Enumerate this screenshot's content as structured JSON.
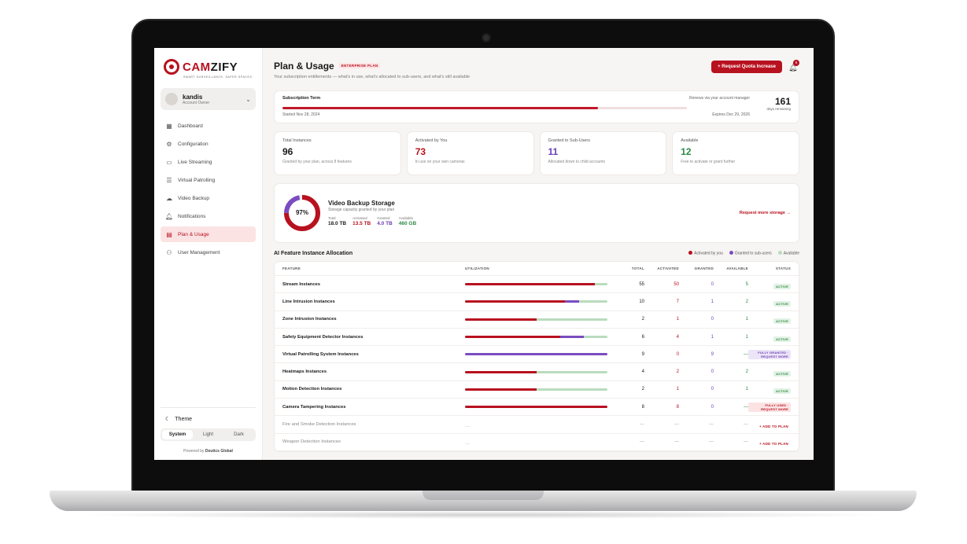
{
  "brand": {
    "name_a": "CAM",
    "name_b": "ZIFY",
    "tagline": "Smart Surveillance, Safer Spaces"
  },
  "user": {
    "name": "kandis",
    "role": "Account Owner"
  },
  "nav": [
    {
      "label": "Dashboard",
      "icon": "grid-icon"
    },
    {
      "label": "Configuration",
      "icon": "gear-icon"
    },
    {
      "label": "Live Streaming",
      "icon": "video-icon"
    },
    {
      "label": "Virtual Patrolling",
      "icon": "server-icon"
    },
    {
      "label": "Video Backup",
      "icon": "cloud-icon"
    },
    {
      "label": "Notifications",
      "icon": "bell-icon"
    },
    {
      "label": "Plan & Usage",
      "icon": "document-icon"
    },
    {
      "label": "User Management",
      "icon": "users-icon"
    }
  ],
  "theme": {
    "title": "Theme",
    "options": [
      "System",
      "Light",
      "Dark"
    ],
    "selected": "System"
  },
  "powered_by": {
    "prefix": "Powered by",
    "name": "Deutics Global"
  },
  "header": {
    "title": "Plan & Usage",
    "badge": "ENTERPRISE PLAN",
    "subtitle": "Your subscription entitlements — what's in use, what's allocated to sub-users, and what's still available",
    "quota_button": "+ Request Quota Increase",
    "notification_count": "6"
  },
  "term": {
    "label": "Subscription Term",
    "started": "Started Nov 28, 2024",
    "renews": "Renews via your account manager",
    "expires": "Expires Dec 29, 2026",
    "days": "161",
    "days_label": "days remaining",
    "progress": 0.78
  },
  "stats": [
    {
      "label": "Total Instances",
      "value": "96",
      "sub": "Granted by your plan, across 8 features",
      "color": "#1a1a1a"
    },
    {
      "label": "Activated by You",
      "value": "73",
      "sub": "In use on your own cameras",
      "color": "#b8111f"
    },
    {
      "label": "Granted to Sub-Users",
      "value": "11",
      "sub": "Allocated down to child accounts",
      "color": "#6b3fb5"
    },
    {
      "label": "Available",
      "value": "12",
      "sub": "Free to activate or grant further",
      "color": "#2f8a46"
    }
  ],
  "storage": {
    "percent_label": "97%",
    "title": "Video Backup Storage",
    "subtitle": "Storage capacity granted by your plan",
    "total_label": "Total",
    "total": "18.0 TB",
    "activated_label": "Activated",
    "activated": "13.5 TB",
    "granted_label": "Granted",
    "granted": "4.0 TB",
    "available_label": "Available",
    "available": "460 GB",
    "link": "Request more storage →"
  },
  "allocation": {
    "title": "AI Feature Instance Allocation",
    "legend": [
      "Activated by you",
      "Granted to sub-users",
      "Available"
    ],
    "columns": [
      "FEATURE",
      "UTILIZATION",
      "TOTAL",
      "ACTIVATED",
      "GRANTED",
      "AVAILABLE",
      "STATUS"
    ],
    "rows": [
      {
        "feature": "Stream Instances",
        "total": "55",
        "activated": "50",
        "granted": "0",
        "available": "5",
        "status": "ACTIVE",
        "kind": "green"
      },
      {
        "feature": "Line Intrusion Instances",
        "total": "10",
        "activated": "7",
        "granted": "1",
        "available": "2",
        "status": "ACTIVE",
        "kind": "green"
      },
      {
        "feature": "Zone Intrusion Instances",
        "total": "2",
        "activated": "1",
        "granted": "0",
        "available": "1",
        "status": "ACTIVE",
        "kind": "green"
      },
      {
        "feature": "Safety Equipment Detector Instances",
        "total": "6",
        "activated": "4",
        "granted": "1",
        "available": "1",
        "status": "ACTIVE",
        "kind": "green"
      },
      {
        "feature": "Virtual Patrolling System Instances",
        "total": "9",
        "activated": "0",
        "granted": "9",
        "available": "—",
        "status": "FULLY GRANTED · REQUEST MORE",
        "kind": "purple"
      },
      {
        "feature": "Heatmaps Instances",
        "total": "4",
        "activated": "2",
        "granted": "0",
        "available": "2",
        "status": "ACTIVE",
        "kind": "green"
      },
      {
        "feature": "Motion Detection Instances",
        "total": "2",
        "activated": "1",
        "granted": "0",
        "available": "1",
        "status": "ACTIVE",
        "kind": "green"
      },
      {
        "feature": "Camera Tampering Instances",
        "total": "8",
        "activated": "8",
        "granted": "0",
        "available": "—",
        "status": "FULLY USED · REQUEST MORE",
        "kind": "red"
      },
      {
        "feature": "Fire and Smoke Detection Instances",
        "total": "—",
        "activated": "—",
        "granted": "—",
        "available": "—",
        "status": "+ ADD TO PLAN",
        "kind": "link"
      },
      {
        "feature": "Weapon Detection Instances",
        "total": "—",
        "activated": "—",
        "granted": "—",
        "available": "—",
        "status": "+ ADD TO PLAN",
        "kind": "link"
      }
    ]
  }
}
